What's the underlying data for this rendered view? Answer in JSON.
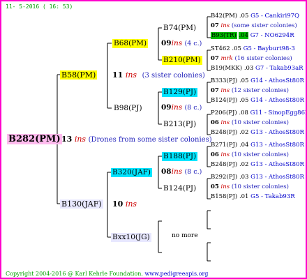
{
  "header": "11- 5-2016 ( 16: 53)",
  "footer": {
    "copyright": "Copyright 2004-2016 @ Karl Kehrle Foundation.",
    "url": "www.pedigreeapis.org"
  },
  "colors": {
    "frame": "#ff00cc",
    "pink": "#ffbbee",
    "yellow": "#ffff00",
    "cyan": "#00e5ff",
    "green": "#00bb00",
    "lavender": "#e8e8ff"
  },
  "root": {
    "name": "B282(PM)",
    "count": "13",
    "ins": "ins",
    "desc": "(Drones from some sister colonies)"
  },
  "left_upper": {
    "name": "B58(PM)",
    "count": "11",
    "ins": "ins",
    "desc": "(3 sister colonies)"
  },
  "left_lower": {
    "name": "B130(JAF)",
    "count": "10",
    "ins": "ins"
  },
  "mid": [
    {
      "name": "B68(PM)",
      "count": "09",
      "ins": "ins",
      "desc": "(4 c.)"
    },
    {
      "name": "B98(PJ)",
      "count": "09",
      "ins": "ins",
      "desc": "(8 c.)"
    },
    {
      "name": "B320(JAF)",
      "count": "08",
      "ins": "ins",
      "desc": "(8 c.)"
    },
    {
      "name": "Bxx10(JG)",
      "desc": "no more"
    }
  ],
  "gp": [
    {
      "name": "B74(PM)"
    },
    {
      "name": "B210(PM)"
    },
    {
      "name": "B129(PJ)"
    },
    {
      "name": "B213(PJ)"
    },
    {
      "name": "B188(PJ)"
    },
    {
      "name": "B124(PJ)"
    }
  ],
  "ggp": [
    {
      "name": "B42(PM)",
      "num": ".05",
      "loc": "G5 - Cankiri97Q"
    },
    {
      "count": "07",
      "ins": "ins",
      "desc": "(some sister colonies)"
    },
    {
      "name": "B93(TR)",
      "num": ".04",
      "loc": "G7 - NO6294R"
    },
    {
      "name": "ST462",
      "num": ".05",
      "loc": "G5 - Bayburt98-3"
    },
    {
      "count": "07",
      "ins": "mrk",
      "desc": "(16 sister colonies)"
    },
    {
      "name": "B19(MKK)",
      "num": ".03",
      "loc": "G7 - Takab93aR"
    },
    {
      "name": "B333(PJ)",
      "num": ".05",
      "loc": "G14 - AthosSt80R"
    },
    {
      "count": "07",
      "ins": "ins",
      "desc": "(12 sister colonies)"
    },
    {
      "name": "B124(PJ)",
      "num": ".05",
      "loc": "G14 - AthosSt80R"
    },
    {
      "name": "P206(PJ)",
      "num": ".08",
      "loc": "G11 - SinopEgg86R"
    },
    {
      "count": "06",
      "ins": "ins",
      "desc": "(10 sister colonies)"
    },
    {
      "name": "B248(PJ)",
      "num": ".02",
      "loc": "G13 - AthosSt80R"
    },
    {
      "name": "B271(PJ)",
      "num": ".04",
      "loc": "G13 - AthosSt80R"
    },
    {
      "count": "06",
      "ins": "ins",
      "desc": "(10 sister colonies)"
    },
    {
      "name": "B248(PJ)",
      "num": ".02",
      "loc": "G13 - AthosSt80R"
    },
    {
      "name": "B292(PJ)",
      "num": ".03",
      "loc": "G13 - AthosSt80R"
    },
    {
      "count": "05",
      "ins": "ins",
      "desc": "(10 sister colonies)"
    },
    {
      "name": "B158(PJ)",
      "num": ".01",
      "loc": "G5 - Takab93R"
    }
  ]
}
